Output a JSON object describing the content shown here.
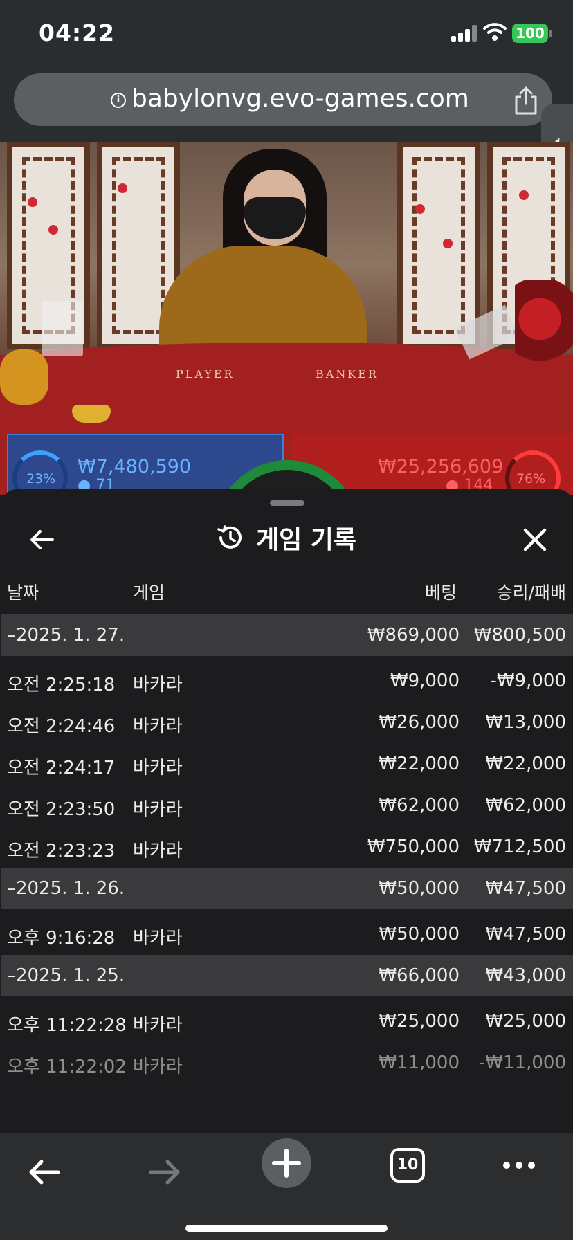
{
  "status_bar": {
    "time": "04:22",
    "battery": "100"
  },
  "browser": {
    "url": "babylonvg.evo-games.com",
    "tab_count": "10"
  },
  "table_overlay": {
    "felt_player": "PLAYER",
    "felt_banker": "BANKER",
    "player": {
      "percent": "23%",
      "amount": "₩7,480,590",
      "players": "71"
    },
    "banker": {
      "percent": "76%",
      "amount": "₩25,256,609",
      "players": "144"
    }
  },
  "sheet": {
    "title": "게임 기록",
    "columns": {
      "date": "날짜",
      "game": "게임",
      "bet": "베팅",
      "win_loss": "승리/패배"
    },
    "groups": [
      {
        "date": "–2025. 1. 27.",
        "bet": "₩869,000",
        "result": "₩800,500",
        "rows": [
          {
            "time": "오전 2:25:18",
            "game": "바카라",
            "bet": "₩9,000",
            "result": "-₩9,000"
          },
          {
            "time": "오전 2:24:46",
            "game": "바카라",
            "bet": "₩26,000",
            "result": "₩13,000"
          },
          {
            "time": "오전 2:24:17",
            "game": "바카라",
            "bet": "₩22,000",
            "result": "₩22,000"
          },
          {
            "time": "오전 2:23:50",
            "game": "바카라",
            "bet": "₩62,000",
            "result": "₩62,000"
          },
          {
            "time": "오전 2:23:23",
            "game": "바카라",
            "bet": "₩750,000",
            "result": "₩712,500"
          }
        ]
      },
      {
        "date": "–2025. 1. 26.",
        "bet": "₩50,000",
        "result": "₩47,500",
        "rows": [
          {
            "time": "오후 9:16:28",
            "game": "바카라",
            "bet": "₩50,000",
            "result": "₩47,500"
          }
        ]
      },
      {
        "date": "–2025. 1. 25.",
        "bet": "₩66,000",
        "result": "₩43,000",
        "rows": [
          {
            "time": "오후 11:22:28",
            "game": "바카라",
            "bet": "₩25,000",
            "result": "₩25,000"
          },
          {
            "time": "오후 11:22:02",
            "game": "바카라",
            "bet": "₩11,000",
            "result": "-₩11,000"
          }
        ]
      }
    ]
  },
  "icons": {
    "back": "arrow-left-icon",
    "close": "close-icon",
    "history": "history-icon",
    "share": "share-icon",
    "new_tab": "plus-icon",
    "more": "ellipsis-icon"
  },
  "colors": {
    "sheet_bg": "#1c1c1e",
    "day_row_bg": "#3a3a3c",
    "battery": "#35c759",
    "player_blue": "#3ea0ff",
    "banker_red": "#ff3b3b"
  }
}
